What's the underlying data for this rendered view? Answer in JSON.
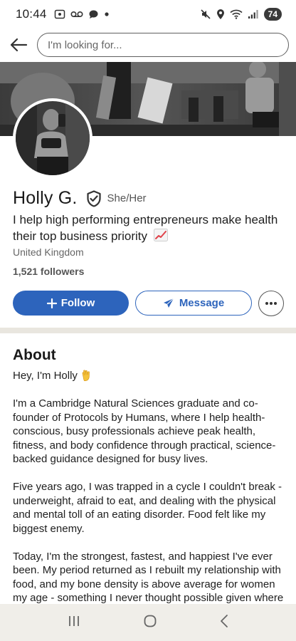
{
  "status": {
    "time": "10:44",
    "battery": "74"
  },
  "search": {
    "placeholder": "I'm looking for..."
  },
  "profile": {
    "name": "Holly G.",
    "pronouns": "She/Her",
    "headline": "I help high performing entrepreneurs make health their top business priority",
    "location": "United Kingdom",
    "followers": "1,521 followers"
  },
  "actions": {
    "follow_label": "Follow",
    "message_label": "Message"
  },
  "about": {
    "title": "About",
    "greeting": "Hey, I'm Holly",
    "paragraphs": [
      "I'm a Cambridge Natural Sciences graduate and co-founder of Protocols by Humans, where I help health-conscious, busy professionals achieve peak health, fitness, and body confidence through practical, science-backed guidance designed for busy lives.",
      "Five years ago, I was trapped in a cycle I couldn't break - underweight, afraid to eat, and dealing with the physical and mental toll of an eating disorder. Food felt like my biggest enemy.",
      "Today, I'm the strongest, fastest, and happiest I've ever been. My period returned as I rebuilt my relationship with food, and my bone density is above average for women my age - something I never thought possible given where"
    ]
  },
  "icons": {
    "back": "arrow-left-icon",
    "verified": "verified-shield-icon",
    "trending": "chart-increasing-emoji",
    "wave": "waving-hand-emoji",
    "plus": "plus-icon",
    "send": "send-icon",
    "more": "more-horizontal-icon"
  },
  "colors": {
    "accent": "#2d64bc",
    "divider": "#e9e6df",
    "navbar": "#f0eee9"
  }
}
